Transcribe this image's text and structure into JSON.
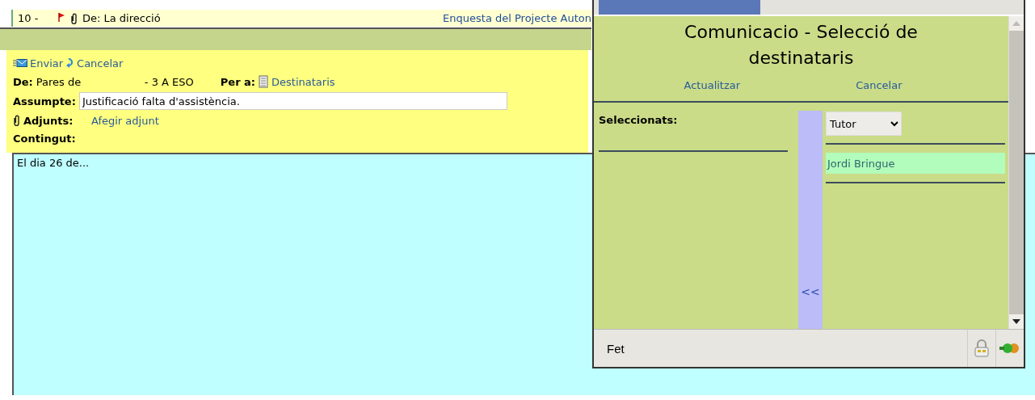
{
  "message_row": {
    "number": "10 -",
    "flagged": true,
    "has_attachment": true,
    "from": "De: La direcció",
    "subject": "Enquesta del Projecte Auton"
  },
  "compose": {
    "actions": [
      {
        "label": "Enviar",
        "kind": "send"
      },
      {
        "label": "Cancelar",
        "kind": "cancel"
      }
    ],
    "from_label": "De:",
    "from_value": "Pares de",
    "from_group": "- 3 A ESO",
    "to_label": "Per a:",
    "to_link": "Destinataris",
    "subject_label": "Assumpte:",
    "subject_value": "Justificació falta d'assistència.",
    "attachments_label": "Adjunts:",
    "attach_link": "Afegir adjunt",
    "content_label": "Contingut:",
    "content_value": "El dia 26 de..."
  },
  "popup": {
    "title": "Comunicacio - Selecció de destinataris",
    "actions": [
      "Actualitzar",
      "Cancelar"
    ],
    "selected_label": "Seleccionats:",
    "move_button": "<<",
    "filter": "Tutor",
    "candidates": [
      {
        "name": "Jordi Bringue",
        "selected": true
      }
    ],
    "status": "Fet"
  }
}
